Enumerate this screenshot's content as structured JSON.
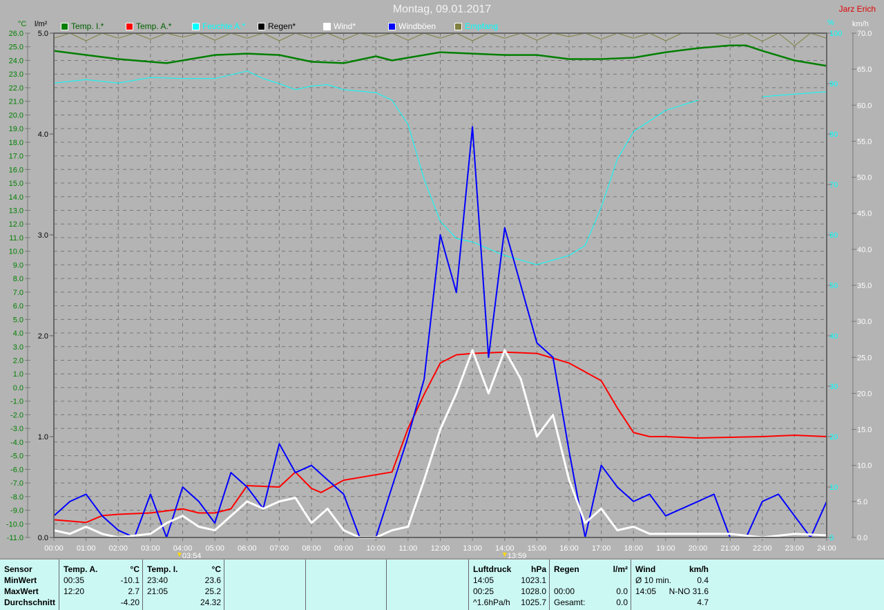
{
  "title": "Montag, 09.01.2017",
  "author": "Jarz Erich",
  "legend": [
    {
      "label": "Temp. I.*",
      "color": "#007f00",
      "text_color": "#006000"
    },
    {
      "label": "Temp. A.*",
      "color": "#ff0000",
      "text_color": "#006000"
    },
    {
      "label": "Feuchte A.*",
      "color": "#00ffff",
      "text_color": "#00ffff"
    },
    {
      "label": "Regen*",
      "color": "#000000",
      "text_color": "#000000"
    },
    {
      "label": "Wind*",
      "color": "#ffffff",
      "text_color": "#ffffff"
    },
    {
      "label": "Windböen",
      "color": "#0000ff",
      "text_color": "#ffffff"
    },
    {
      "label": "Empfang",
      "color": "#808040",
      "text_color": "#00ffff"
    }
  ],
  "markers": [
    {
      "time": "03:54",
      "hour": 3.9,
      "icon": "sunrise-icon"
    },
    {
      "time": "13:59",
      "hour": 14.0,
      "icon": "sun-peak-icon"
    }
  ],
  "chart_data": {
    "type": "line",
    "title": "Montag, 09.01.2017",
    "x_ticks": [
      "00:00",
      "01:00",
      "02:00",
      "03:00",
      "04:00",
      "05:00",
      "06:00",
      "07:00",
      "08:00",
      "09:00",
      "10:00",
      "11:00",
      "12:00",
      "13:00",
      "14:00",
      "15:00",
      "16:00",
      "17:00",
      "18:00",
      "19:00",
      "20:00",
      "21:00",
      "22:00",
      "23:00",
      "24:00"
    ],
    "axes": {
      "temp": {
        "label": "°C",
        "range": [
          -11,
          26
        ],
        "step": 1
      },
      "rain": {
        "label": "l/m²",
        "range": [
          0,
          5
        ],
        "step": 1
      },
      "humidity": {
        "label": "%",
        "range": [
          0,
          100
        ],
        "step": 10
      },
      "wind": {
        "label": "km/h",
        "range": [
          0,
          70
        ],
        "step": 5
      }
    },
    "series": [
      {
        "name": "Temp. I.",
        "axis": "temp",
        "color": "#007f00",
        "width": 2.5,
        "x": [
          0,
          2,
          3.5,
          5,
          6,
          7,
          8,
          9,
          10,
          10.5,
          12,
          14,
          15,
          16,
          17,
          18,
          19,
          20,
          21,
          21.5,
          22,
          23,
          24
        ],
        "y": [
          24.7,
          24.1,
          23.8,
          24.4,
          24.5,
          24.4,
          23.9,
          23.8,
          24.3,
          24.0,
          24.6,
          24.4,
          24.4,
          24.1,
          24.1,
          24.2,
          24.6,
          24.9,
          25.1,
          25.1,
          24.7,
          24.0,
          23.6
        ]
      },
      {
        "name": "Temp. A.",
        "axis": "temp",
        "color": "#ff0000",
        "width": 2,
        "x": [
          0,
          1,
          1.5,
          2,
          3,
          4,
          4.5,
          5,
          5.5,
          6,
          7,
          7.5,
          8,
          8.3,
          9,
          10,
          10.5,
          11,
          11.5,
          12,
          12.5,
          13,
          14,
          15,
          16,
          17,
          17.5,
          18,
          18.5,
          19,
          20,
          22,
          23,
          24
        ],
        "y": [
          -9.7,
          -9.9,
          -9.4,
          -9.3,
          -9.2,
          -8.9,
          -9.2,
          -9.2,
          -8.9,
          -7.2,
          -7.3,
          -6.2,
          -7.4,
          -7.7,
          -6.8,
          -6.4,
          -6.2,
          -3.0,
          -0.5,
          1.8,
          2.4,
          2.5,
          2.6,
          2.5,
          1.8,
          0.5,
          -1.5,
          -3.3,
          -3.6,
          -3.6,
          -3.7,
          -3.6,
          -3.5,
          -3.6
        ]
      },
      {
        "name": "Feuchte A.",
        "axis": "humidity",
        "color": "#00ffff",
        "width": 1,
        "x": [
          0,
          1,
          2,
          3,
          4,
          5,
          6,
          6.5,
          7,
          7.5,
          8,
          8.5,
          9,
          10,
          10.5,
          11,
          11.5,
          12,
          12.5,
          13,
          14,
          15,
          16,
          16.5,
          17,
          17.5,
          18,
          19,
          20,
          null,
          22,
          23,
          24
        ],
        "y": [
          90.1,
          90.8,
          90.1,
          91.2,
          91.0,
          91.0,
          92.5,
          91.0,
          90.0,
          88.8,
          89.5,
          89.8,
          88.8,
          88.2,
          86.7,
          81.9,
          71,
          62.7,
          59.3,
          58.6,
          55.9,
          54.1,
          55.9,
          57.9,
          65.5,
          75,
          80.5,
          84.7,
          86.7,
          null,
          87.4,
          87.9,
          88.4
        ]
      },
      {
        "name": "Wind",
        "axis": "wind",
        "color": "#ffffff",
        "width": 3,
        "x": [
          0,
          0.5,
          1,
          1.5,
          2,
          3,
          3.5,
          4,
          4.5,
          5,
          5.5,
          6,
          6.5,
          7,
          7.5,
          8,
          8.5,
          9,
          9.5,
          10,
          10.5,
          11,
          11.5,
          12,
          12.5,
          13,
          13.5,
          14,
          14.5,
          15,
          15.5,
          16,
          16.5,
          17,
          17.5,
          18,
          18.5,
          19,
          20,
          21,
          22,
          23,
          24
        ],
        "y": [
          1,
          0.5,
          1.5,
          0.5,
          0,
          0.5,
          2,
          3,
          1.5,
          1,
          3,
          5,
          4,
          5,
          5.5,
          2,
          4,
          1,
          0,
          0,
          1,
          1.5,
          8,
          15,
          20,
          26,
          20,
          26,
          22,
          14,
          17,
          8,
          2,
          4,
          1,
          1.5,
          0.5,
          0.5,
          0.5,
          0.5,
          0,
          0.5,
          0.3
        ]
      },
      {
        "name": "Windböen",
        "axis": "wind",
        "color": "#0000ff",
        "width": 2,
        "x": [
          0,
          0.5,
          1,
          1.5,
          2,
          2.5,
          3,
          3.5,
          4,
          4.5,
          5,
          5.5,
          6,
          6.5,
          7,
          7.5,
          8,
          8.5,
          9,
          9.5,
          10,
          10.5,
          11,
          11.5,
          12,
          12.5,
          13,
          13.5,
          14,
          14.5,
          15,
          15.5,
          16,
          16.5,
          17,
          17.5,
          18,
          18.5,
          19,
          19.5,
          20,
          20.5,
          21,
          21.5,
          22,
          22.5,
          23,
          23.5,
          24
        ],
        "y": [
          3,
          5,
          6,
          3,
          1,
          0,
          6,
          0,
          7,
          5,
          2,
          9,
          7,
          4,
          13,
          9,
          10,
          8,
          6,
          0,
          0,
          7,
          14,
          22,
          42,
          34,
          57,
          25,
          43,
          35,
          27,
          25,
          12,
          0,
          10,
          7,
          5,
          6,
          3,
          4,
          5,
          6,
          0,
          0,
          5,
          6,
          3,
          0,
          5
        ]
      },
      {
        "name": "Empfang",
        "axis": "humidity",
        "color": "#808040",
        "width": 1,
        "x": [
          0,
          0.5,
          1,
          1.5,
          2,
          2.5,
          3,
          3.5,
          4,
          4.5,
          5,
          5.5,
          6,
          6.5,
          7,
          7.5,
          8,
          8.5,
          9,
          9.5,
          10,
          10.5,
          11,
          11.5,
          12,
          12.5,
          13,
          13.5,
          14,
          14.5,
          15,
          15.5,
          16,
          16.5,
          17,
          17.5,
          18,
          18.5,
          19,
          19.5,
          20,
          20.5,
          21,
          21.5,
          22,
          22.5,
          23,
          23.5,
          24
        ],
        "y": [
          99,
          100,
          98.5,
          100,
          99,
          100,
          98.8,
          100,
          99.2,
          100,
          98.6,
          100,
          99,
          100,
          98.5,
          100,
          99,
          100,
          98.7,
          100,
          99.2,
          100,
          98.6,
          100,
          99,
          100,
          98.5,
          100,
          99,
          100,
          98.6,
          100,
          99.3,
          100,
          98.8,
          100,
          99,
          100,
          98.5,
          100,
          100,
          100,
          99,
          100,
          98.4,
          100,
          97.5,
          100,
          99
        ]
      }
    ]
  },
  "table": {
    "sensor": {
      "header": "Sensor",
      "rows": [
        "MinWert",
        "MaxWert",
        "Durchschnitt"
      ]
    },
    "temp_a": {
      "header": "Temp. A.",
      "unit": "°C",
      "rows": [
        [
          "00:35",
          "-10.1"
        ],
        [
          "12:20",
          "2.7"
        ],
        [
          "",
          "-4.20"
        ]
      ]
    },
    "temp_i": {
      "header": "Temp. I.",
      "unit": "°C",
      "rows": [
        [
          "23:40",
          "23.6"
        ],
        [
          "21:05",
          "25.2"
        ],
        [
          "",
          "24.32"
        ]
      ]
    },
    "pressure": {
      "header": "Luftdruck",
      "unit": "hPa",
      "rows": [
        [
          "14:05",
          "1023.1"
        ],
        [
          "00:25",
          "1028.0"
        ],
        [
          "^1.6hPa/h",
          "1025.7"
        ]
      ]
    },
    "rain": {
      "header": "Regen",
      "unit": "l/m²",
      "rows": [
        [
          "",
          ""
        ],
        [
          "00:00",
          "0.0"
        ],
        [
          "Gesamt:",
          "0.0"
        ]
      ]
    },
    "wind": {
      "header": "Wind",
      "unit": "km/h",
      "rows": [
        [
          "Ø 10 min.",
          "0.4"
        ],
        [
          "14:05",
          "N-NO 31.6"
        ],
        [
          "",
          "4.7"
        ]
      ]
    }
  }
}
